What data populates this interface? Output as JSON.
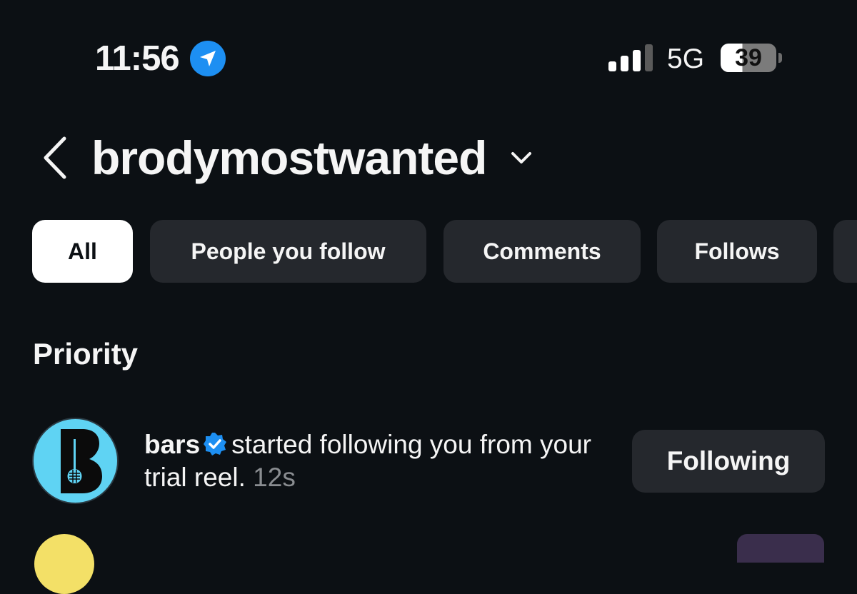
{
  "status_bar": {
    "time": "11:56",
    "location_icon": "location-arrow-icon",
    "network": "5G",
    "battery": "39",
    "battery_level": 0.39,
    "accent_color": "#1d8ff2"
  },
  "header": {
    "username": "brodymostwanted",
    "back_icon": "chevron-left-icon",
    "switch_icon": "chevron-down-icon"
  },
  "filters": [
    {
      "label": "All",
      "active": true
    },
    {
      "label": "People you follow",
      "active": false
    },
    {
      "label": "Comments",
      "active": false
    },
    {
      "label": "Follows",
      "active": false
    },
    {
      "label": "",
      "active": false
    }
  ],
  "section": {
    "title": "Priority"
  },
  "notifications": [
    {
      "username": "bars",
      "verified": true,
      "text": "started following you from your trial reel.",
      "time_ago": "12s",
      "action_label": "Following",
      "avatar_letter": "B",
      "avatar_color": "#5fd3f3"
    }
  ]
}
